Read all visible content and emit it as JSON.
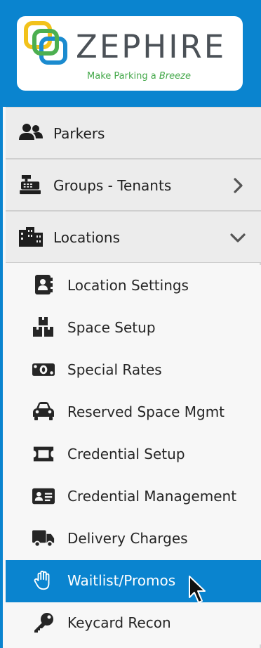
{
  "brand": {
    "name": "ZEPHIRE",
    "tagline_start": "Make Parking a ",
    "tagline_emph": "Breeze",
    "colors": {
      "header_bg": "#0a84cf",
      "logo_yellow": "#f2c21b",
      "logo_green": "#4caf50",
      "logo_blue": "#1b8bcf",
      "tagline": "#44a84a"
    }
  },
  "menu": {
    "parkers": {
      "label": "Parkers",
      "icon": "users-icon"
    },
    "groups": {
      "label": "Groups - Tenants",
      "icon": "cash-register-icon",
      "chevron": "chevron-right-icon"
    },
    "locations": {
      "label": "Locations",
      "icon": "building-icon",
      "chevron": "chevron-down-icon",
      "expanded": true
    },
    "location_items": [
      {
        "label": "Location Settings",
        "icon": "address-book-icon"
      },
      {
        "label": "Space Setup",
        "icon": "boxes-icon"
      },
      {
        "label": "Special Rates",
        "icon": "money-bill-icon"
      },
      {
        "label": "Reserved Space Mgmt",
        "icon": "car-icon"
      },
      {
        "label": "Credential Setup",
        "icon": "ticket-icon"
      },
      {
        "label": "Credential Management",
        "icon": "id-card-icon"
      },
      {
        "label": "Delivery Charges",
        "icon": "truck-icon"
      },
      {
        "label": "Waitlist/Promos",
        "icon": "hand-paper-icon",
        "active": true
      },
      {
        "label": "Keycard Recon",
        "icon": "key-icon"
      }
    ]
  }
}
